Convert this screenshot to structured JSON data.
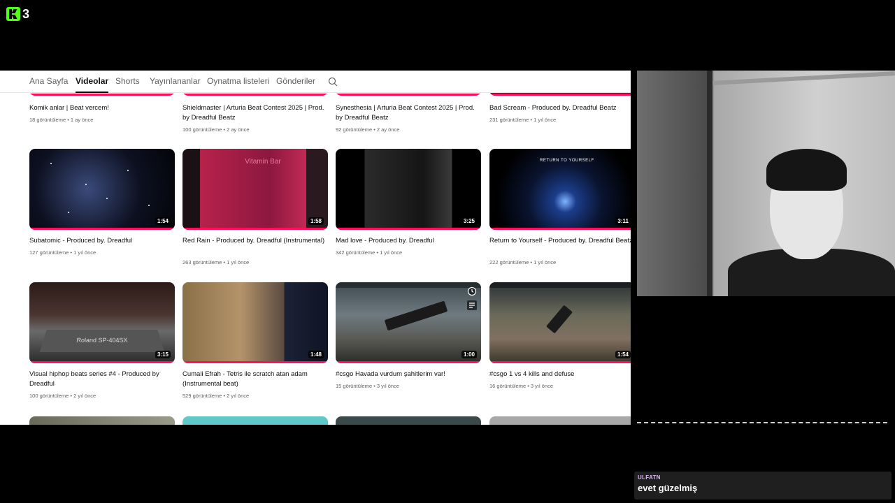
{
  "stream": {
    "viewer_count": "3",
    "brand_color": "#53fc18"
  },
  "youtube": {
    "tabs": [
      "Ana Sayfa",
      "Videolar",
      "Shorts",
      "Yayınlananlar",
      "Oynatma listeleri",
      "Gönderiler"
    ],
    "active_tab": "Videolar",
    "progress_color": "#ff0f5b",
    "videos": [
      {
        "title": "Komik anlar | Beat vercem!",
        "meta": "18 görüntüleme • 1 ay önce"
      },
      {
        "title": "Shieldmaster | Arturia Beat Contest 2025 | Prod. by Dreadful Beatz",
        "meta": "100 görüntüleme • 2 ay önce"
      },
      {
        "title": "Synesthesia | Arturia Beat Contest 2025 | Prod. by Dreadful Beatz",
        "meta": "92 görüntüleme • 2 ay önce"
      },
      {
        "title": "Bad Scream - Produced by. Dreadful Beatz",
        "meta": "231 görüntüleme • 1 yıl önce"
      },
      {
        "title": "Subatomic - Produced by. Dreadful",
        "meta": "127 görüntüleme • 1 yıl önce",
        "duration": "1:54"
      },
      {
        "title": "Red Rain - Produced by. Dreadful (Instrumental)",
        "meta": "263 görüntüleme • 1 yıl önce",
        "duration": "1:58"
      },
      {
        "title": "Mad love - Produced by. Dreadful",
        "meta": "342 görüntüleme • 1 yıl önce",
        "duration": "3:25"
      },
      {
        "title": "Return to Yourself - Produced by. Dreadful Beatz",
        "meta": "222 görüntüleme • 1 yıl önce",
        "duration": "3:11"
      },
      {
        "title": "Visual hiphop beats series #4 - Produced by Dreadful",
        "meta": "100 görüntüleme • 2 yıl önce",
        "duration": "3:15"
      },
      {
        "title": "Cumali Efrah - Tetris ile scratch atan adam (Instrumental beat)",
        "meta": "529 görüntüleme • 2 yıl önce",
        "duration": "1:48"
      },
      {
        "title": "#csgo Havada vurdum şahitlerim var!",
        "meta": "15 görüntüleme • 3 yıl önce",
        "duration": "1:00"
      },
      {
        "title": "#csgo 1 vs 4 kills and defuse",
        "meta": "16 görüntüleme • 3 yıl önce",
        "duration": "1:54"
      }
    ],
    "thumb_texts": {
      "red_rain_sign": "Vitamin Bar",
      "return_text": "RETURN TO YOURSELF",
      "sp404": "Roland SP-404SX"
    }
  },
  "chat": {
    "username": "ULFATN",
    "message": "evet güzelmiş"
  }
}
